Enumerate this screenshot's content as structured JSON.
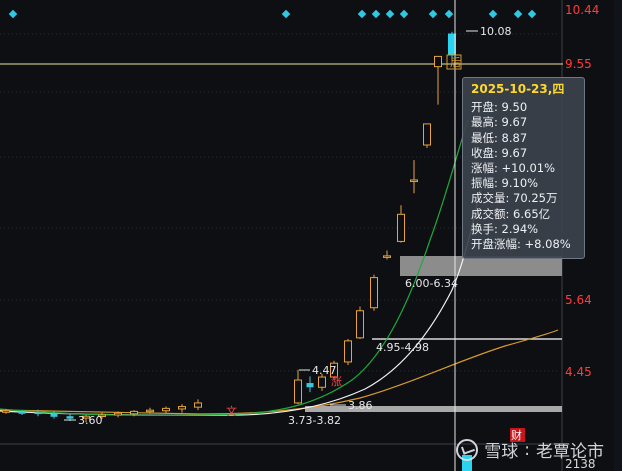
{
  "price_axis": {
    "labels": [
      "10.44",
      "9.55",
      "5.64",
      "4.45"
    ]
  },
  "volume_label": "2138",
  "max_label": "10.08",
  "min_label": "3.60",
  "last_price_label": "9.55",
  "annotations": [
    {
      "text": "4.47"
    },
    {
      "text": "3.86"
    },
    {
      "text": "3.73-3.82"
    },
    {
      "text": "4.95-4.98"
    },
    {
      "text": "6.00-6.34"
    }
  ],
  "markers": {
    "zhang": "涨",
    "wen": "文",
    "cai": "财",
    "hou": "后"
  },
  "tooltip": {
    "date": "2025-10-23,四",
    "rows": [
      {
        "label": "开盘",
        "value": "9.50"
      },
      {
        "label": "最高",
        "value": "9.67"
      },
      {
        "label": "最低",
        "value": "8.87"
      },
      {
        "label": "收盘",
        "value": "9.67"
      },
      {
        "label": "涨幅",
        "value": "+10.01%"
      },
      {
        "label": "振幅",
        "value": "9.10%"
      },
      {
        "label": "成交量",
        "value": "70.25万"
      },
      {
        "label": "成交额",
        "value": "6.65亿"
      },
      {
        "label": "换手",
        "value": "2.94%"
      },
      {
        "label": "开盘涨幅",
        "value": "+8.08%"
      }
    ]
  },
  "watermark": {
    "brand": "雪球",
    "author": "老覃论市"
  },
  "colors": {
    "up": "#e8a33a",
    "up_fill": "#0d0f13",
    "limit_up": "#2ad4f0",
    "down": "#3fc5d8",
    "ma_green": "#1faa3c",
    "ma_white": "#f2f2f2",
    "ma_orange": "#d89a2c",
    "price_red": "#ff3b3b",
    "band_gray": "#a8a8a8",
    "marker_cyan": "#2fc9e4"
  },
  "chart_data": {
    "type": "candlestick",
    "y_axis_labels": [
      10.44,
      9.55,
      5.64,
      4.45
    ],
    "candles": [
      {
        "o": 3.78,
        "h": 3.82,
        "l": 3.74,
        "c": 3.79
      },
      {
        "o": 3.77,
        "h": 3.8,
        "l": 3.72,
        "c": 3.74
      },
      {
        "o": 3.76,
        "h": 3.81,
        "l": 3.7,
        "c": 3.75
      },
      {
        "o": 3.74,
        "h": 3.78,
        "l": 3.66,
        "c": 3.69
      },
      {
        "o": 3.7,
        "h": 3.74,
        "l": 3.62,
        "c": 3.66
      },
      {
        "o": 3.67,
        "h": 3.72,
        "l": 3.6,
        "c": 3.7
      },
      {
        "o": 3.7,
        "h": 3.76,
        "l": 3.66,
        "c": 3.72
      },
      {
        "o": 3.72,
        "h": 3.78,
        "l": 3.68,
        "c": 3.75
      },
      {
        "o": 3.74,
        "h": 3.8,
        "l": 3.7,
        "c": 3.78
      },
      {
        "o": 3.78,
        "h": 3.84,
        "l": 3.74,
        "c": 3.8
      },
      {
        "o": 3.79,
        "h": 3.86,
        "l": 3.75,
        "c": 3.83
      },
      {
        "o": 3.82,
        "h": 3.9,
        "l": 3.76,
        "c": 3.86
      },
      {
        "o": 3.85,
        "h": 3.98,
        "l": 3.8,
        "c": 3.92
      },
      {
        "o": 3.92,
        "h": 4.47,
        "l": 3.9,
        "c": 4.3
      },
      {
        "o": 4.25,
        "h": 4.36,
        "l": 4.1,
        "c": 4.18
      },
      {
        "o": 4.18,
        "h": 4.4,
        "l": 4.12,
        "c": 4.35
      },
      {
        "o": 4.35,
        "h": 4.62,
        "l": 4.3,
        "c": 4.58
      },
      {
        "o": 4.6,
        "h": 4.98,
        "l": 4.55,
        "c": 4.95
      },
      {
        "o": 5.0,
        "h": 5.52,
        "l": 4.98,
        "c": 5.45
      },
      {
        "o": 5.5,
        "h": 6.05,
        "l": 5.45,
        "c": 6.0
      },
      {
        "o": 6.34,
        "h": 6.45,
        "l": 6.3,
        "c": 6.36
      },
      {
        "o": 6.6,
        "h": 7.2,
        "l": 6.58,
        "c": 7.05
      },
      {
        "o": 7.6,
        "h": 7.95,
        "l": 7.4,
        "c": 7.62
      },
      {
        "o": 8.2,
        "h": 8.55,
        "l": 8.15,
        "c": 8.55
      },
      {
        "o": 9.5,
        "h": 9.67,
        "l": 8.87,
        "c": 9.67
      },
      {
        "o": 9.7,
        "h": 10.08,
        "l": 9.6,
        "c": 10.05
      }
    ]
  }
}
